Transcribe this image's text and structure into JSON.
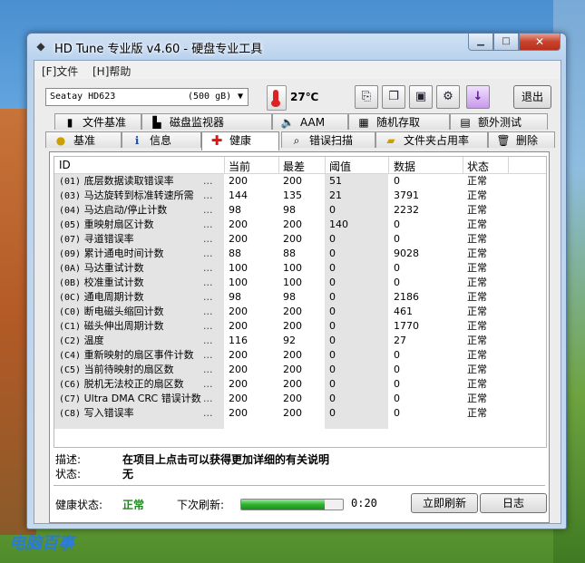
{
  "window": {
    "title": "HD Tune 专业版 v4.60 - 硬盘专业工具"
  },
  "menu": [
    "[F]文件",
    "[H]帮助"
  ],
  "toolbar": {
    "drive_name": "Seatay  HD623",
    "drive_size": "(500 gB)",
    "temperature": "27℃",
    "exit_label": "退出"
  },
  "tabs_row1": [
    {
      "label": "文件基准",
      "icon": "bar-chart-icon"
    },
    {
      "label": "磁盘监视器",
      "icon": "monitor-chart-icon"
    },
    {
      "label": "AAM",
      "icon": "speaker-icon"
    },
    {
      "label": "随机存取",
      "icon": "random-access-icon"
    },
    {
      "label": "额外测试",
      "icon": "extra-test-icon"
    }
  ],
  "tabs_row2": [
    {
      "label": "基准",
      "icon": "benchmark-icon"
    },
    {
      "label": "信息",
      "icon": "info-icon"
    },
    {
      "label": "健康",
      "icon": "health-cross-icon"
    },
    {
      "label": "错误扫描",
      "icon": "magnifier-icon"
    },
    {
      "label": "文件夹占用率",
      "icon": "folder-icon"
    },
    {
      "label": "删除",
      "icon": "trash-icon"
    }
  ],
  "table": {
    "headers": [
      "ID",
      "当前",
      "最差",
      "阈值",
      "数据",
      "状态"
    ],
    "rows": [
      {
        "code": "(01)",
        "name": "底层数据读取错误率",
        "cur": "200",
        "worst": "200",
        "thr": "51",
        "data": "0",
        "status": "正常"
      },
      {
        "code": "(03)",
        "name": "马达旋转到标准转速所需",
        "cur": "144",
        "worst": "135",
        "thr": "21",
        "data": "3791",
        "status": "正常"
      },
      {
        "code": "(04)",
        "name": "马达启动/停止计数",
        "cur": "98",
        "worst": "98",
        "thr": "0",
        "data": "2232",
        "status": "正常"
      },
      {
        "code": "(05)",
        "name": "重映射扇区计数",
        "cur": "200",
        "worst": "200",
        "thr": "140",
        "data": "0",
        "status": "正常"
      },
      {
        "code": "(07)",
        "name": "寻道错误率",
        "cur": "200",
        "worst": "200",
        "thr": "0",
        "data": "0",
        "status": "正常"
      },
      {
        "code": "(09)",
        "name": "累计通电时间计数",
        "cur": "88",
        "worst": "88",
        "thr": "0",
        "data": "9028",
        "status": "正常"
      },
      {
        "code": "(0A)",
        "name": "马达重试计数",
        "cur": "100",
        "worst": "100",
        "thr": "0",
        "data": "0",
        "status": "正常"
      },
      {
        "code": "(0B)",
        "name": "校准重试计数",
        "cur": "100",
        "worst": "100",
        "thr": "0",
        "data": "0",
        "status": "正常"
      },
      {
        "code": "(0C)",
        "name": "通电周期计数",
        "cur": "98",
        "worst": "98",
        "thr": "0",
        "data": "2186",
        "status": "正常"
      },
      {
        "code": "(C0)",
        "name": "断电磁头缩回计数",
        "cur": "200",
        "worst": "200",
        "thr": "0",
        "data": "461",
        "status": "正常"
      },
      {
        "code": "(C1)",
        "name": "磁头伸出周期计数",
        "cur": "200",
        "worst": "200",
        "thr": "0",
        "data": "1770",
        "status": "正常"
      },
      {
        "code": "(C2)",
        "name": "温度",
        "cur": "116",
        "worst": "92",
        "thr": "0",
        "data": "27",
        "status": "正常"
      },
      {
        "code": "(C4)",
        "name": "重新映射的扇区事件计数",
        "cur": "200",
        "worst": "200",
        "thr": "0",
        "data": "0",
        "status": "正常"
      },
      {
        "code": "(C5)",
        "name": "当前待映射的扇区数",
        "cur": "200",
        "worst": "200",
        "thr": "0",
        "data": "0",
        "status": "正常"
      },
      {
        "code": "(C6)",
        "name": "脱机无法校正的扇区数",
        "cur": "200",
        "worst": "200",
        "thr": "0",
        "data": "0",
        "status": "正常"
      },
      {
        "code": "(C7)",
        "name": "Ultra DMA CRC 错误计数",
        "cur": "200",
        "worst": "200",
        "thr": "0",
        "data": "0",
        "status": "正常"
      },
      {
        "code": "(C8)",
        "name": "写入错误率",
        "cur": "200",
        "worst": "200",
        "thr": "0",
        "data": "0",
        "status": "正常"
      }
    ]
  },
  "description": {
    "desc_label": "描述:",
    "desc_value": "在项目上点击可以获得更加详细的有关说明",
    "state_label": "状态:",
    "state_value": "无"
  },
  "health": {
    "label": "健康状态:",
    "value": "正常",
    "next_refresh_label": "下次刷新:",
    "progress": 0.82,
    "timer": "0:20",
    "refresh_button": "立即刷新",
    "log_button": "日志"
  },
  "watermark": "电脑百事",
  "colors": {
    "healthy": "#1c8a1c",
    "close_button": "#c8432c"
  }
}
